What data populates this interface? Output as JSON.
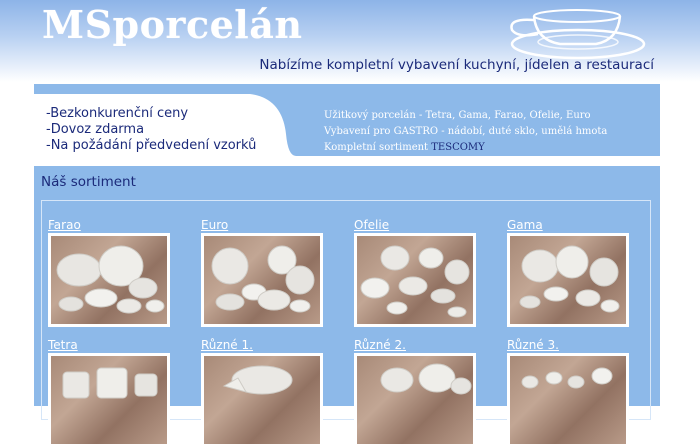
{
  "header": {
    "logo": "MSporcelán",
    "tagline": "Nabízíme kompletní vybavení kuchyní, jídelen a restaurací"
  },
  "banner": {
    "features": [
      "-Bezkonkurenční ceny",
      "-Dovoz zdarma",
      "-Na požádání předvedení vzorků"
    ],
    "info": {
      "line1": "Užitkový porcelán - Tetra, Gama, Farao, Ofelie, Euro",
      "line2": "Vybavení pro GASTRO - nádobí, duté sklo, umělá hmota",
      "line3_prefix": "Kompletní sortiment ",
      "line3_brand": "TESCOMY"
    }
  },
  "catalog": {
    "title": "Náš sortiment",
    "items": [
      {
        "label": "Farao"
      },
      {
        "label": "Euro"
      },
      {
        "label": "Ofelie"
      },
      {
        "label": "Gama"
      },
      {
        "label": "Tetra"
      },
      {
        "label": "Různé 1."
      },
      {
        "label": "Různé 2."
      },
      {
        "label": "Různé 3."
      }
    ]
  },
  "colors": {
    "header_blue": "#8db4e8",
    "panel_blue": "#8db9e9",
    "text_navy": "#1b2a7a",
    "photo_background": "#a88a78"
  }
}
